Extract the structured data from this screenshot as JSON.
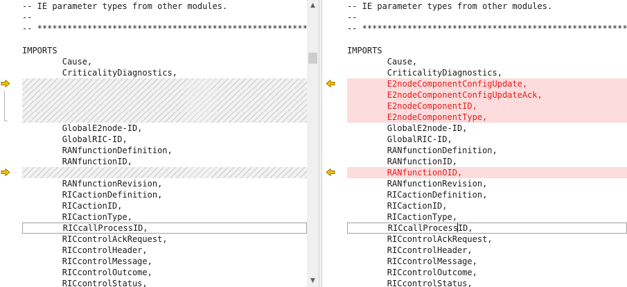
{
  "colors": {
    "added_bg": "#fcdcdc",
    "added_text": "#e81c1c",
    "hatch": "#c8c8c8",
    "marker_fill": "#f2c200"
  },
  "icons": {
    "left_marker": "arrow-right-icon",
    "right_marker": "arrow-left-icon",
    "scroll_up": "chevron-up-icon",
    "scroll_down": "chevron-down-icon"
  },
  "left_pane": {
    "lines": [
      "-- IE parameter types from other modules.",
      "--",
      "-- ****************************************************************",
      "",
      "IMPORTS",
      "        Cause,",
      "        CriticalityDiagnostics,",
      "",
      "",
      "",
      "",
      "        GlobalE2node-ID,",
      "        GlobalRIC-ID,",
      "        RANfunctionDefinition,",
      "        RANfunctionID,",
      "",
      "        RANfunctionRevision,",
      "        RICactionDefinition,",
      "        RICactionID,",
      "        RICactionType,",
      "        RICcallProcessID,",
      "        RICcontrolAckRequest,",
      "        RICcontrolHeader,",
      "        RICcontrolMessage,",
      "        RICcontrolOutcome,",
      "        RICcontrolStatus,"
    ]
  },
  "right_pane": {
    "lines": [
      "-- IE parameter types from other modules.",
      "--",
      "-- ****************************************************************",
      "",
      "IMPORTS",
      "        Cause,",
      "        CriticalityDiagnostics,",
      "        E2nodeComponentConfigUpdate,",
      "        E2nodeComponentConfigUpdateAck,",
      "        E2nodeComponentID,",
      "        E2nodeComponentType,",
      "        GlobalE2node-ID,",
      "        GlobalRIC-ID,",
      "        RANfunctionDefinition,",
      "        RANfunctionID,",
      "        RANfunctionOID,",
      "        RANfunctionRevision,",
      "        RICactionDefinition,",
      "        RICactionID,",
      "        RICactionType,",
      "        RICcallProcessID,",
      "        RICcontrolAckRequest,",
      "        RICcontrolHeader,",
      "        RICcontrolMessage,",
      "        RICcontrolOutcome,",
      "        RICcontrolStatus,"
    ]
  }
}
